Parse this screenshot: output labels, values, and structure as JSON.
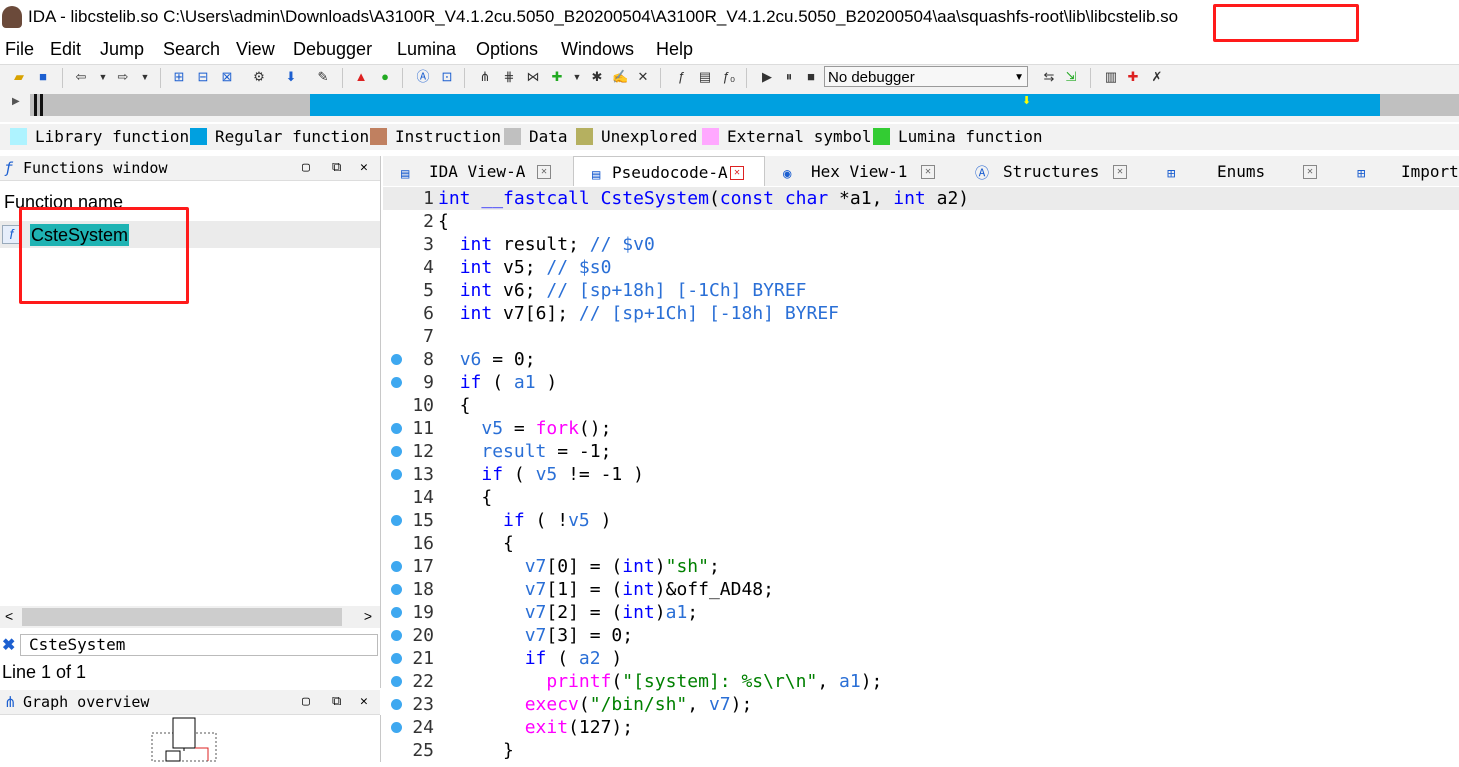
{
  "window": {
    "title": "IDA - libcstelib.so C:\\Users\\admin\\Downloads\\A3100R_V4.1.2cu.5050_B20200504\\A3100R_V4.1.2cu.5050_B20200504\\aa\\squashfs-root\\lib\\libcstelib.so"
  },
  "menu": [
    "File",
    "Edit",
    "Jump",
    "Search",
    "View",
    "Debugger",
    "Lumina",
    "Options",
    "Windows",
    "Help"
  ],
  "toolbar": {
    "debugger_select": "No debugger"
  },
  "legend": [
    {
      "label": "Library function",
      "color": "#aef3ff"
    },
    {
      "label": "Regular function",
      "color": "#00a0e0"
    },
    {
      "label": "Instruction",
      "color": "#c08060"
    },
    {
      "label": "Data",
      "color": "#c0c0c0"
    },
    {
      "label": "Unexplored",
      "color": "#b5b060"
    },
    {
      "label": "External symbol",
      "color": "#ffa8ff"
    },
    {
      "label": "Lumina function",
      "color": "#33cc33"
    }
  ],
  "functions_window": {
    "title": "Functions window",
    "column": "Function name",
    "rows": [
      "CsteSystem"
    ],
    "filter": "CsteSystem",
    "line_info": "Line 1 of 1"
  },
  "graph_overview": {
    "title": "Graph overview"
  },
  "tabs": [
    {
      "label": "IDA View-A",
      "active": false
    },
    {
      "label": "Pseudocode-A",
      "active": true
    },
    {
      "label": "Hex View-1",
      "active": false
    },
    {
      "label": "Structures",
      "active": false
    },
    {
      "label": "Enums",
      "active": false
    },
    {
      "label": "Imports",
      "active": false
    }
  ],
  "code_lines": [
    "int __fastcall CsteSystem(const char *a1, int a2)",
    "{",
    "  int result; // $v0",
    "  int v5; // $s0",
    "  int v6; // [sp+18h] [-1Ch] BYREF",
    "  int v7[6]; // [sp+1Ch] [-18h] BYREF",
    "",
    "  v6 = 0;",
    "  if ( a1 )",
    "  {",
    "    v5 = fork();",
    "    result = -1;",
    "    if ( v5 != -1 )",
    "    {",
    "      if ( !v5 )",
    "      {",
    "        v7[0] = (int)\"sh\";",
    "        v7[1] = (int)&off_AD48;",
    "        v7[2] = (int)a1;",
    "        v7[3] = 0;",
    "        if ( a2 )",
    "          printf(\"[system]: %s\\r\\n\", a1);",
    "        execv(\"/bin/sh\", v7);",
    "        exit(127);",
    "      }"
  ],
  "breakpoint_lines": [
    8,
    9,
    11,
    12,
    13,
    15,
    17,
    18,
    19,
    20,
    21,
    22,
    23,
    24
  ]
}
